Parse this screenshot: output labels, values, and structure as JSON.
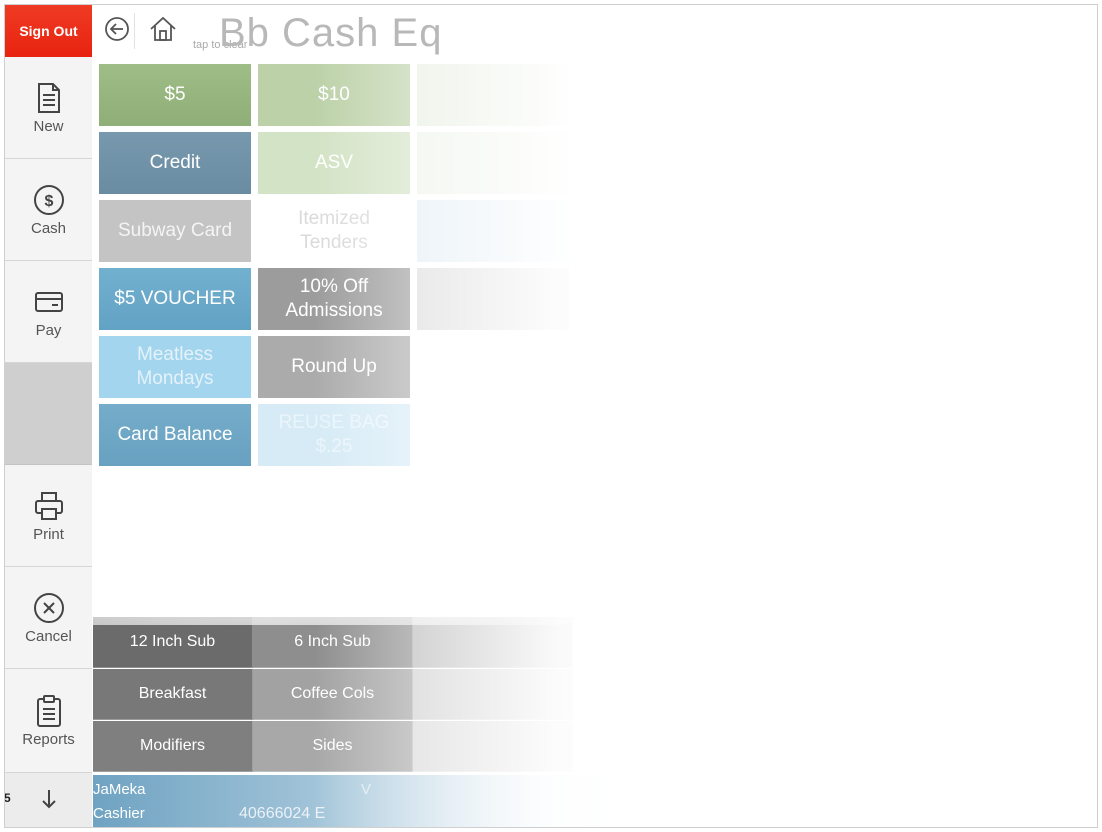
{
  "sidebar": {
    "sign_out": "Sign Out",
    "new": "New",
    "cash": "Cash",
    "pay": "Pay",
    "print": "Print",
    "cancel": "Cancel",
    "reports": "Reports",
    "corner_number": "5"
  },
  "header": {
    "title": "Bb Cash Eq",
    "tap_to_clear": "tap to clear",
    "back_icon": "back-arrow-icon",
    "home_icon": "home-icon"
  },
  "tenders": [
    {
      "label": "$5",
      "color": "#98b57e"
    },
    {
      "label": "$10",
      "color": "#b9cfa5"
    },
    {
      "label": "Credit",
      "color": "#6f93a9"
    },
    {
      "label": "ASV",
      "color": "#cfe1bf"
    },
    {
      "label": "Subway Card",
      "color": "#c4c4c4"
    },
    {
      "label": "Itemized Tenders",
      "color": "#ffffff"
    },
    {
      "label": "$5 VOUCHER",
      "color": "#6aa9c9"
    },
    {
      "label": "10% Off Admissions",
      "color": "#9a9a9a"
    },
    {
      "label": "Meatless Mondays",
      "color": "#9fd3ec"
    },
    {
      "label": "Round Up",
      "color": "#a9a9a9"
    },
    {
      "label": "Card Balance",
      "color": "#6fa6c6"
    },
    {
      "label": "REUSE BAG $.25",
      "color": "#d3e9f5"
    }
  ],
  "categories": [
    {
      "label": "12 Inch Sub"
    },
    {
      "label": "6 Inch Sub"
    },
    {
      "label": "Breakfast"
    },
    {
      "label": "Coffee Cols"
    },
    {
      "label": "Modifiers"
    },
    {
      "label": "Sides"
    }
  ],
  "footer": {
    "user": "JaMeka",
    "role": "Cashier",
    "code": "40666024 E",
    "tag": "V"
  }
}
